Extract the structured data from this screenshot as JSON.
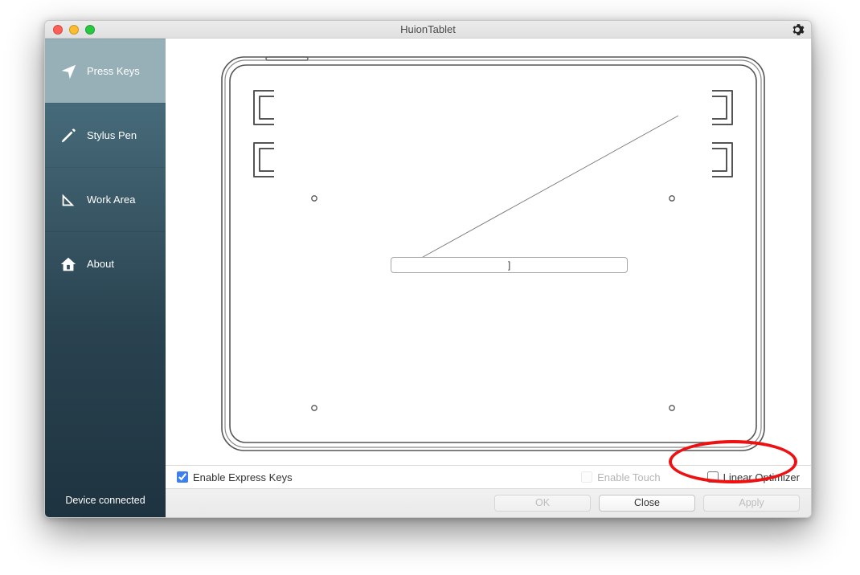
{
  "window": {
    "title": "HuionTablet"
  },
  "sidebar": {
    "items": [
      {
        "label": "Press Keys"
      },
      {
        "label": "Stylus Pen"
      },
      {
        "label": "Work Area"
      },
      {
        "label": "About"
      }
    ],
    "status": "Device connected"
  },
  "options": {
    "enable_express_keys_label": "Enable Express Keys",
    "enable_touch_label": "Enable Touch",
    "linear_optimizer_label": "Linear Optimizer"
  },
  "buttons": {
    "ok": "OK",
    "close": "Close",
    "apply": "Apply"
  },
  "tablet_field_value": "]"
}
